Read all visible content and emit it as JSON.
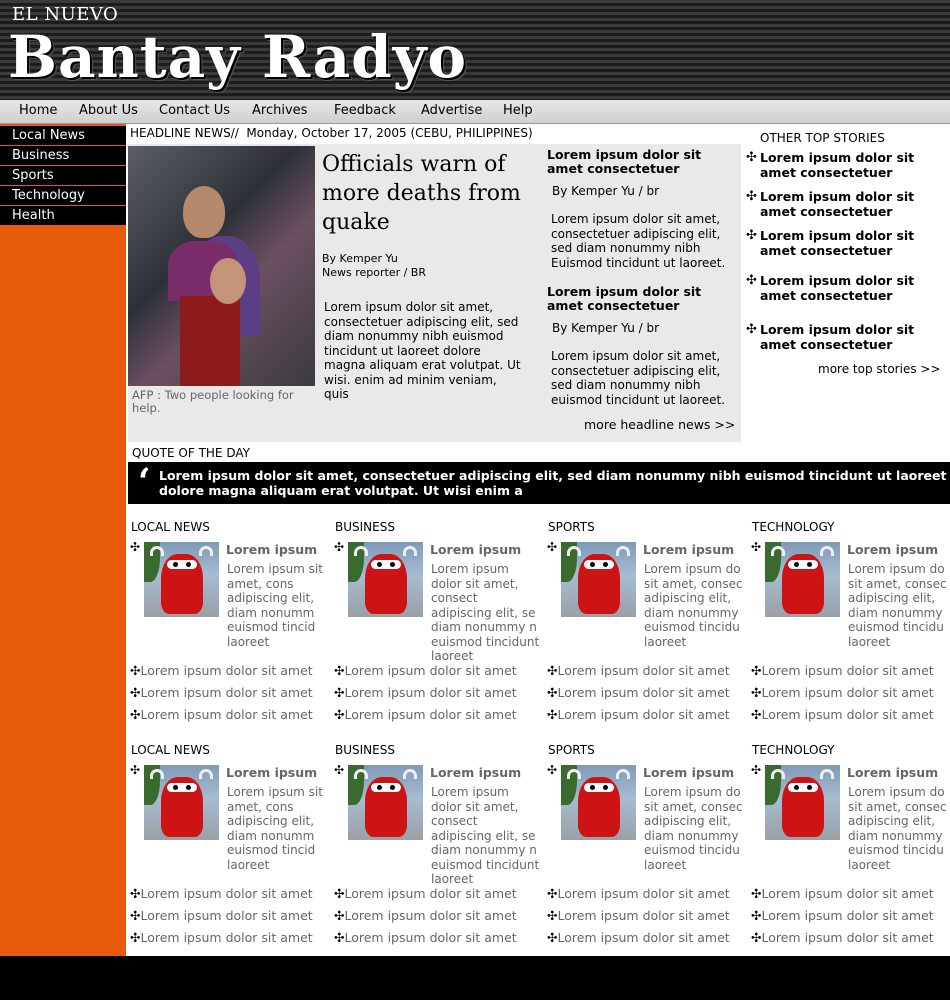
{
  "header": {
    "kicker": "EL NUEVO",
    "brand": "Bantay Radyo"
  },
  "topnav": [
    "Home",
    "About Us",
    "Contact Us",
    "Archives",
    "Feedback",
    "Advertise",
    "Help"
  ],
  "sidebar": [
    "Local News",
    "Business",
    "Sports",
    "Technology",
    "Health"
  ],
  "headline": {
    "bar": "HEADLINE NEWS//  Monday, October 17, 2005 (CEBU, PHILIPPINES)",
    "caption": "AFP : Two people looking for help.",
    "lead_title": "Officials warn of more deaths from quake",
    "lead_byline_1": "By Kemper Yu",
    "lead_byline_2": "News reporter / BR",
    "lead_body": "Lorem ipsum dolor sit amet, consectetuer adipiscing elit, sed diam nonummy nibh euismod tincidunt ut laoreet dolore magna aliquam erat volutpat. Ut wisi. enim ad minim veniam,  quis",
    "side_stories": [
      {
        "title": "Lorem ipsum dolor sit amet consectetuer",
        "byline": "By Kemper Yu / br",
        "body": "Lorem ipsum dolor sit amet, consectetuer adipiscing elit, sed diam nonummy nibh Euismod tincidunt ut laoreet."
      },
      {
        "title": "Lorem ipsum dolor sit amet consectetuer",
        "byline": "By Kemper Yu / br",
        "body": "Lorem ipsum dolor sit amet, consectetuer adipiscing elit, sed diam nonummy nibh euismod tincidunt ut laoreet."
      }
    ],
    "more": "more headline news >>"
  },
  "other_top": {
    "title": "OTHER TOP STORIES",
    "items": [
      "Lorem ipsum dolor sit amet consectetuer",
      "Lorem ipsum dolor sit amet consectetuer",
      "Lorem ipsum dolor sit amet consectetuer",
      "Lorem ipsum dolor sit amet consectetuer",
      "Lorem ipsum dolor sit amet consectetuer"
    ],
    "more": "more top stories >>"
  },
  "quote": {
    "label": "QUOTE OF THE DAY",
    "mark": "‘",
    "text": "Lorem ipsum dolor sit amet, consectetuer adipiscing elit, sed diam nonummy nibh euismod tincidunt ut laoreet dolore magna aliquam erat volutpat. Ut wisi enim a"
  },
  "bullet": "✣",
  "categories": [
    {
      "title": "LOCAL NEWS",
      "lead": "Lorem ipsum",
      "text": "Lorem ipsum sit amet, cons adipiscing elit, diam nonumm euismod tincid laoreet",
      "links": [
        "Lorem ipsum dolor sit amet",
        "Lorem ipsum dolor sit amet",
        "Lorem ipsum dolor sit amet"
      ]
    },
    {
      "title": "BUSINESS",
      "lead": "Lorem ipsum",
      "text": "Lorem ipsum dolor sit amet, consect adipiscing elit, se diam nonummy n euismod tincidunt laoreet",
      "links": [
        "Lorem ipsum dolor sit amet",
        "Lorem ipsum dolor sit amet",
        "Lorem ipsum dolor sit amet"
      ]
    },
    {
      "title": "SPORTS",
      "lead": "Lorem ipsum",
      "text": "Lorem ipsum do sit amet, consec adipiscing elit, diam nonummy euismod tincidu laoreet",
      "links": [
        "Lorem ipsum dolor sit amet",
        "Lorem ipsum dolor sit amet",
        "Lorem ipsum dolor sit amet"
      ]
    },
    {
      "title": "TECHNOLOGY",
      "lead": "Lorem ipsum",
      "text": "Lorem ipsum do sit amet, consec adipiscing elit, diam nonummy euismod tincidu laoreet",
      "links": [
        "Lorem ipsum dolor sit amet",
        "Lorem ipsum dolor sit amet",
        "Lorem ipsum dolor sit amet"
      ]
    },
    {
      "title": "LOCAL NEWS",
      "lead": "Lorem ipsum",
      "text": "Lorem ipsum sit amet, cons adipiscing elit, diam nonumm euismod tincid laoreet",
      "links": [
        "Lorem ipsum dolor sit amet",
        "Lorem ipsum dolor sit amet",
        "Lorem ipsum dolor sit amet"
      ]
    },
    {
      "title": "BUSINESS",
      "lead": "Lorem ipsum",
      "text": "Lorem ipsum dolor sit amet, consect adipiscing elit, se diam nonummy n euismod tincidunt laoreet",
      "links": [
        "Lorem ipsum dolor sit amet",
        "Lorem ipsum dolor sit amet",
        "Lorem ipsum dolor sit amet"
      ]
    },
    {
      "title": "SPORTS",
      "lead": "Lorem ipsum",
      "text": "Lorem ipsum do sit amet, consec adipiscing elit, diam nonummy euismod tincidu laoreet",
      "links": [
        "Lorem ipsum dolor sit amet",
        "Lorem ipsum dolor sit amet",
        "Lorem ipsum dolor sit amet"
      ]
    },
    {
      "title": "TECHNOLOGY",
      "lead": "Lorem ipsum",
      "text": "Lorem ipsum do sit amet, consec adipiscing elit, diam nonummy euismod tincidu laoreet",
      "links": [
        "Lorem ipsum dolor sit amet",
        "Lorem ipsum dolor sit amet",
        "Lorem ipsum dolor sit amet"
      ]
    }
  ],
  "colors": {
    "sidebar": "#e85b0a",
    "header": "#1c1c1c",
    "quote_bg": "#000000"
  }
}
